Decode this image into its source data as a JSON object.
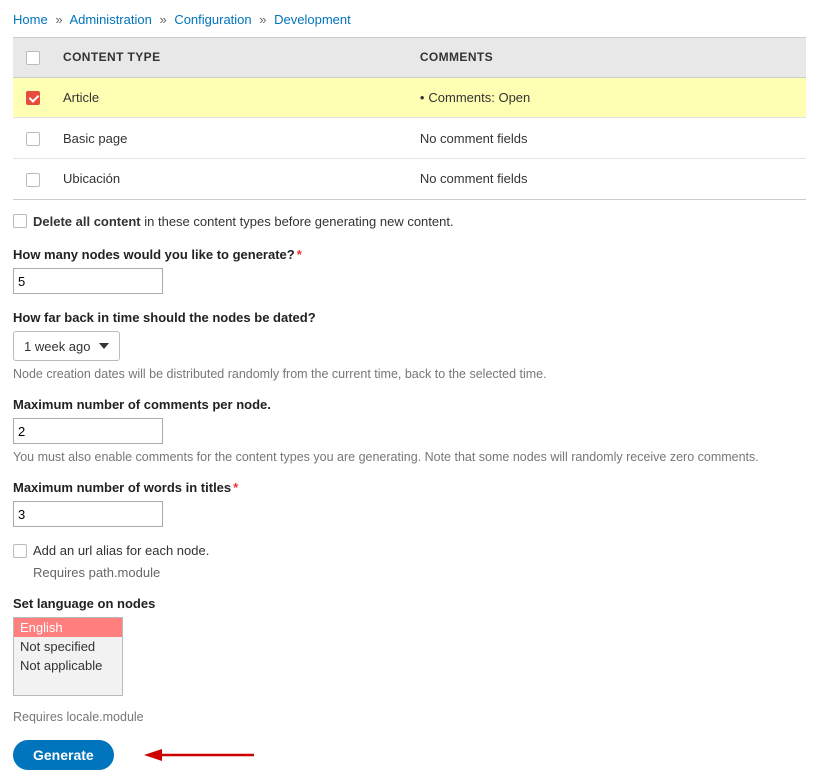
{
  "breadcrumb": {
    "home": "Home",
    "admin": "Administration",
    "config": "Configuration",
    "dev": "Development"
  },
  "table": {
    "header_type": "CONTENT TYPE",
    "header_comments": "COMMENTS",
    "rows": [
      {
        "type": "Article",
        "comments": "Comments: Open",
        "bullet": "•",
        "checked": true
      },
      {
        "type": "Basic page",
        "comments": "No comment fields",
        "bullet": "",
        "checked": false
      },
      {
        "type": "Ubicación",
        "comments": "No comment fields",
        "bullet": "",
        "checked": false
      }
    ]
  },
  "delete": {
    "strong": "Delete all content",
    "rest": " in these content types before generating new content."
  },
  "nodes_count": {
    "label": "How many nodes would you like to generate?",
    "value": "5"
  },
  "date_back": {
    "label": "How far back in time should the nodes be dated?",
    "value": "1 week ago",
    "desc": "Node creation dates will be distributed randomly from the current time, back to the selected time."
  },
  "max_comments": {
    "label": "Maximum number of comments per node.",
    "value": "2",
    "desc": "You must also enable comments for the content types you are generating. Note that some nodes will randomly receive zero comments."
  },
  "max_words": {
    "label": "Maximum number of words in titles",
    "value": "3"
  },
  "alias": {
    "label": "Add an url alias for each node.",
    "note": "Requires path.module"
  },
  "language": {
    "label": "Set language on nodes",
    "options": [
      "English",
      "Not specified",
      "Not applicable"
    ],
    "note": "Requires locale.module"
  },
  "submit": {
    "label": "Generate"
  }
}
